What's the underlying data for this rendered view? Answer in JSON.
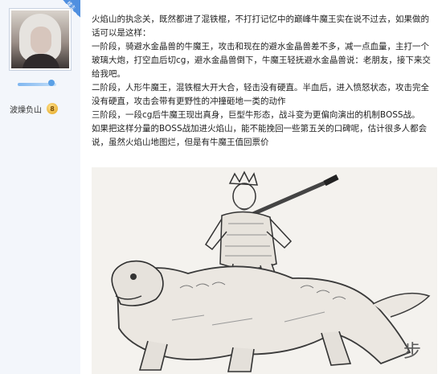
{
  "author": {
    "username": "波燥负山",
    "level_badge": "8",
    "op_tag": "楼主"
  },
  "post": {
    "paragraphs": [
      "火焰山的执念关，既然都进了混铁棍，不打打记忆中的巅峰牛魔王实在说不过去，如果做的话可以是这样：",
      "一阶段，骑避水金晶兽的牛魔王，攻击和现在的避水金晶兽差不多，减一点血量，主打一个玻璃大炮，打空血后切cg，避水金晶兽倒下，牛魔王轻抚避水金晶兽说：老朋友，接下来交给我吧。",
      "二阶段，人形牛魔王，混铁棍大开大合，轻击没有硬直。半血后，进入愤怒状态，攻击完全没有硬直，攻击会带有更野性的冲撞砸地一类的动作",
      "三阶段，一段cg后牛魔王现出真身，巨型牛形态，战斗变为更偏向演出的机制BOSS战。",
      "如果把这样分量的BOSS战加进火焰山，能不能挽回一些第五关的口碑呢，估计很多人都会说，虽然火焰山地图烂，但是有牛魔王值回票价"
    ]
  },
  "image": {
    "subject": "ink sketch of Bull Demon King riding a beast",
    "signature": "步"
  }
}
